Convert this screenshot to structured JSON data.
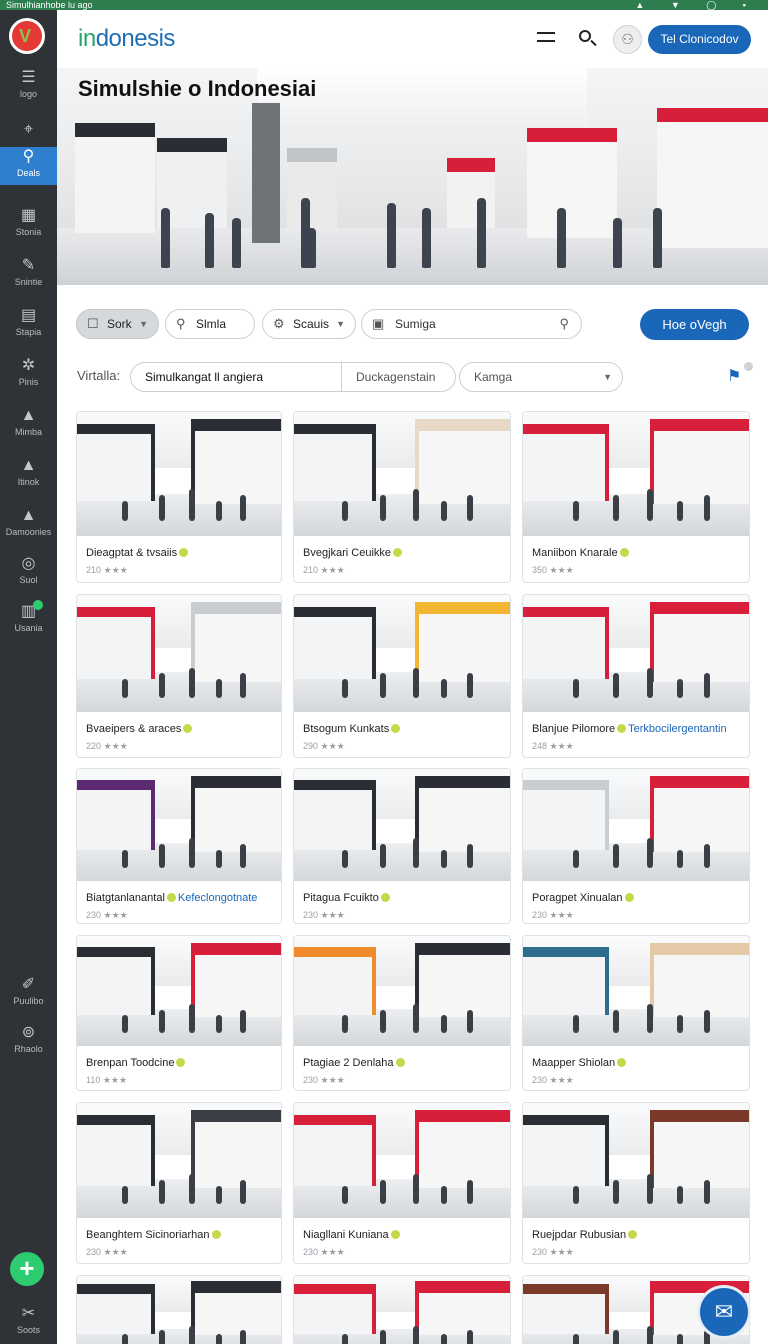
{
  "statusbar": {
    "text": "Simulhianhobe lu ago",
    "icons": "▲ ▼ ◯ ▪"
  },
  "sidebar": {
    "logo_letter": "V",
    "items": [
      {
        "label": "logo",
        "icon": "menu-icon",
        "glyph": "☰"
      },
      {
        "label": "",
        "icon": "pin-icon",
        "glyph": "⌖"
      },
      {
        "label": "Deals",
        "icon": "bike-icon",
        "glyph": "⚲",
        "active": true
      },
      {
        "label": "Stonia",
        "icon": "building-icon",
        "glyph": "▦"
      },
      {
        "label": "Snintie",
        "icon": "tools-icon",
        "glyph": "✎"
      },
      {
        "label": "Stapia",
        "icon": "list-icon",
        "glyph": "▤"
      },
      {
        "label": "Pinis",
        "icon": "gear-icon",
        "glyph": "✲"
      },
      {
        "label": "Mimba",
        "icon": "mountain-icon",
        "glyph": "▲"
      },
      {
        "label": "Itinok",
        "icon": "mountain-icon",
        "glyph": "▲"
      },
      {
        "label": "Damoonies",
        "icon": "mountain-icon",
        "glyph": "▲"
      },
      {
        "label": "Suol",
        "icon": "search-icon",
        "glyph": "◎"
      },
      {
        "label": "Usania",
        "icon": "chart-icon",
        "glyph": "▥"
      },
      {
        "label": "Puulibo",
        "icon": "pen-icon",
        "glyph": "✐"
      },
      {
        "label": "Rhaolo",
        "icon": "settings-icon",
        "glyph": "⊚"
      },
      {
        "label": "Soots",
        "icon": "tools-icon",
        "glyph": "✂"
      }
    ],
    "fab": "+"
  },
  "header": {
    "brand_prefix": "in",
    "brand_rest": "donesis",
    "avatar_glyph": "⚇",
    "cta": "Tel Clonicodov"
  },
  "hero": {
    "title": "Simulshie o Indonesiai"
  },
  "filters": {
    "sort": {
      "label": "Sork",
      "icon": "square-icon"
    },
    "chip2": {
      "label": "Slmla",
      "icon": "search-icon"
    },
    "chip3": {
      "label": "Scauis",
      "icon": "tag-icon"
    },
    "search": {
      "value": "Sumiga",
      "icon": "calendar-icon"
    },
    "primary_button": "Hoe oVegh"
  },
  "subfilters": {
    "label": "Virtalla:",
    "input1": "Simulkangat ll angiera",
    "input2": "Duckagenstain",
    "select": "Kamga"
  },
  "cards": [
    {
      "title": "Dieagptat & tvsaiis",
      "tag": "",
      "meta": "210 ★★★"
    },
    {
      "title": "Bvegjkari Ceuikke",
      "tag": "",
      "meta": "210 ★★★"
    },
    {
      "title": "Maniibon Knarale",
      "tag": "",
      "meta": "350 ★★★"
    },
    {
      "title": "Bvaeipers & araces",
      "tag": "",
      "meta": "220 ★★★"
    },
    {
      "title": "Btsogum Kunkats",
      "tag": "",
      "meta": "290 ★★★"
    },
    {
      "title": "Blanjue Pilomore",
      "tag": "Terkbocilergentantin",
      "meta": "248 ★★★"
    },
    {
      "title": "Biatgtanlanantal",
      "tag": "Kefeclongotnate",
      "meta": "230 ★★★"
    },
    {
      "title": "Pitagua Fcuikto",
      "tag": "",
      "meta": "230 ★★★"
    },
    {
      "title": "Poragpet Xinualan",
      "tag": "",
      "meta": "230 ★★★"
    },
    {
      "title": "Brenpan Toodcine",
      "tag": "",
      "meta": "110 ★★★"
    },
    {
      "title": "Ptagiae 2 Denlaha",
      "tag": "",
      "meta": "230 ★★★"
    },
    {
      "title": "Maapper Shiolan",
      "tag": "",
      "meta": "230 ★★★"
    },
    {
      "title": "Beanghtem Sicinoriarhan",
      "tag": "",
      "meta": "230 ★★★"
    },
    {
      "title": "Niagllani Kuniana",
      "tag": "",
      "meta": "230 ★★★"
    },
    {
      "title": "Ruejpdar Rubusian",
      "tag": "",
      "meta": "230 ★★★"
    },
    {
      "title": "",
      "tag": "",
      "meta": ""
    },
    {
      "title": "",
      "tag": "",
      "meta": ""
    },
    {
      "title": "",
      "tag": "",
      "meta": ""
    }
  ],
  "colors": {
    "accent": "#1a66b8",
    "sidebar": "#2f3337",
    "active": "#2f7fd0",
    "brand_green": "#29a36a",
    "store_red": "#d81f3a",
    "store_dark": "#2a2d33"
  }
}
